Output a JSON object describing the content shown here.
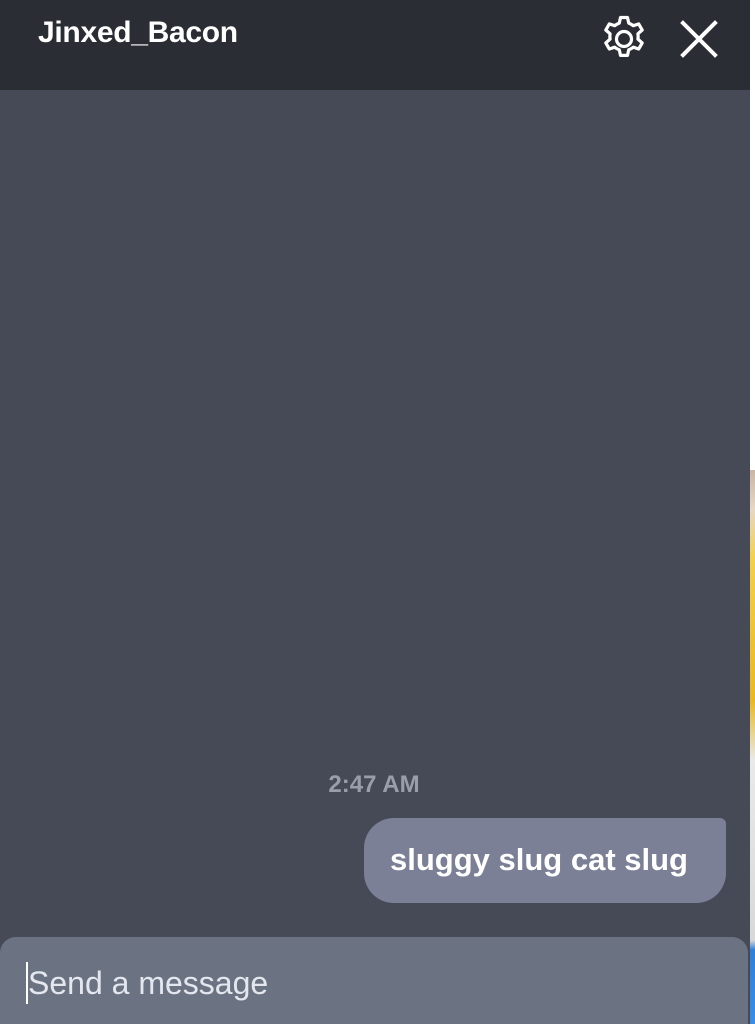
{
  "chat": {
    "title": "Jinxed_Bacon",
    "icons": {
      "settings": "gear-icon",
      "close": "close-icon"
    }
  },
  "messages": [
    {
      "timestamp": "2:47 AM",
      "text": "sluggy slug cat slug",
      "direction": "outgoing"
    }
  ],
  "composer": {
    "placeholder": "Send a message",
    "value": ""
  },
  "colors": {
    "header_bg": "#2b2d35",
    "body_bg": "#464a57",
    "bubble_bg": "#7b8097",
    "composer_bg": "#6b7382",
    "timestamp": "#9a9eab"
  }
}
